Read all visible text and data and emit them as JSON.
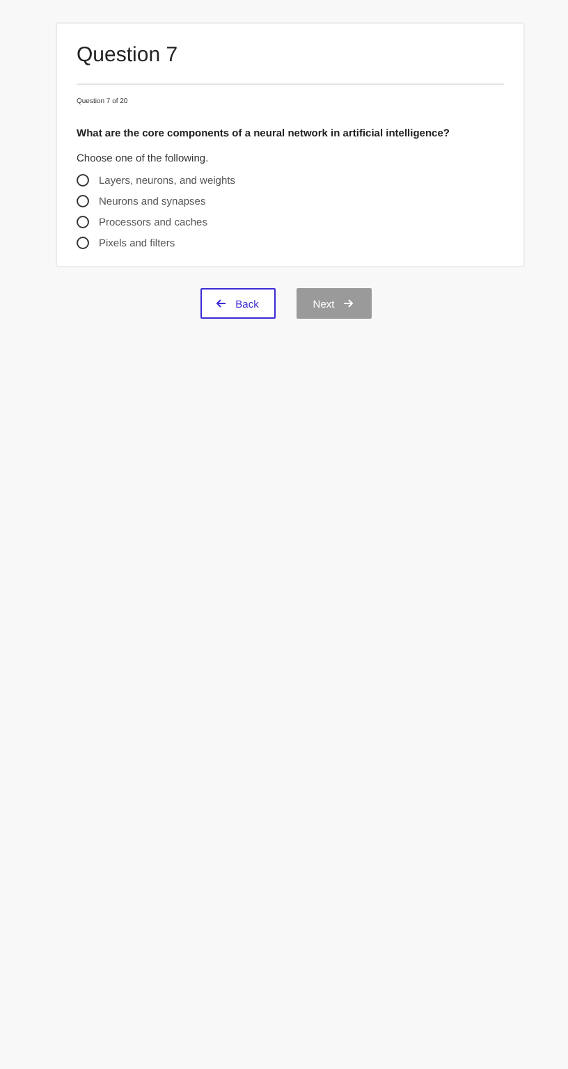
{
  "title": "Question 7",
  "progress": "Question 7 of 20",
  "question": "What are the core components of a neural network in artificial intelligence?",
  "instruction": "Choose one of the following.",
  "options": [
    {
      "label": "Layers, neurons, and weights",
      "selected": false
    },
    {
      "label": "Neurons and synapses",
      "selected": false
    },
    {
      "label": "Processors and caches",
      "selected": false
    },
    {
      "label": "Pixels and filters",
      "selected": false
    }
  ],
  "buttons": [
    {
      "kind": "back",
      "label": "Back",
      "disabled": false
    },
    {
      "kind": "next",
      "label": "Next",
      "disabled": true
    }
  ]
}
